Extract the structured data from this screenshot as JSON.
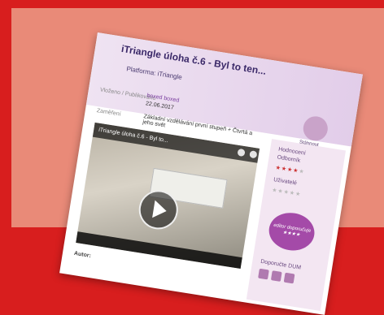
{
  "page": {
    "title": "iTriangle úloha č.6 - Byl to ten...",
    "platform_label": "Platforma:",
    "platform_value": "iTriangle"
  },
  "meta": {
    "published_label": "Vloženo / Publikováno",
    "author": "boxed boxed",
    "date": "22.06.2017",
    "focus_label": "Zaměření",
    "focus_text": "Základní vzdělávání první stupeň + Čtvrtá a jeho svět"
  },
  "video": {
    "title": "iTriangle úloha č.6 - Byl to..."
  },
  "sidebar": {
    "download_label": "Stáhnout",
    "rating_label": "Hodnocení",
    "expert_label": "Odborník",
    "expert_stars": 4,
    "user_label": "Uživatelé",
    "user_stars": 0,
    "badge_text": "editor doporučuje ★★★★",
    "share_label": "Doporučte DUM"
  },
  "footer": {
    "author_stub": "Autor:"
  },
  "colors": {
    "background": "#d81e1e",
    "panel": "#e98a78",
    "accent": "#7b3fa0"
  }
}
